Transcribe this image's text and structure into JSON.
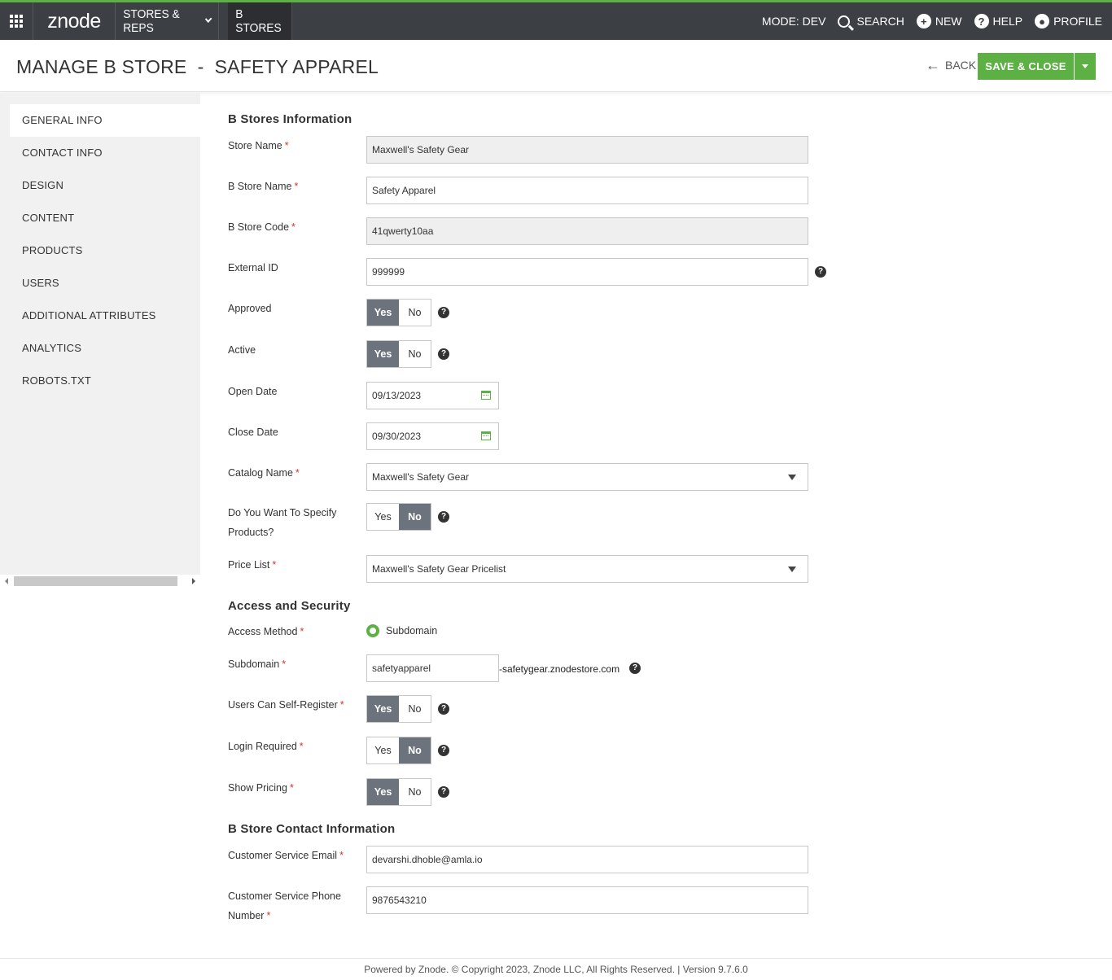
{
  "topbar": {
    "logo": "znode",
    "nav_stores": "STORES & REPS",
    "nav_bstores": "B STORES",
    "mode": "MODE: DEV",
    "search": "SEARCH",
    "new": "NEW",
    "help": "HELP",
    "profile": "PROFILE"
  },
  "header": {
    "title": "MANAGE B STORE  -  SAFETY APPAREL",
    "back": "BACK",
    "save_close": "SAVE & CLOSE"
  },
  "sidebar": {
    "items": [
      {
        "label": "GENERAL INFO",
        "active": true
      },
      {
        "label": "CONTACT INFO"
      },
      {
        "label": "DESIGN"
      },
      {
        "label": "CONTENT"
      },
      {
        "label": "PRODUCTS"
      },
      {
        "label": "USERS"
      },
      {
        "label": "ADDITIONAL ATTRIBUTES"
      },
      {
        "label": "ANALYTICS"
      },
      {
        "label": "ROBOTS.TXT"
      }
    ]
  },
  "sections": {
    "info": "B Stores Information",
    "access": "Access and Security",
    "contact": "B Store Contact Information"
  },
  "form": {
    "store_name": {
      "label": "Store Name",
      "value": "Maxwell's Safety Gear"
    },
    "bstore_name": {
      "label": "B Store Name",
      "value": "Safety Apparel"
    },
    "bstore_code": {
      "label": "B Store Code",
      "value": "41qwerty10aa"
    },
    "external_id": {
      "label": "External ID",
      "value": "999999"
    },
    "approved": {
      "label": "Approved",
      "value": "Yes"
    },
    "active": {
      "label": "Active",
      "value": "Yes"
    },
    "open_date": {
      "label": "Open Date",
      "value": "09/13/2023"
    },
    "close_date": {
      "label": "Close Date",
      "value": "09/30/2023"
    },
    "catalog_name": {
      "label": "Catalog Name",
      "value": "Maxwell's Safety Gear"
    },
    "specify_products": {
      "label": "Do You Want To Specify Products?",
      "value": "No"
    },
    "price_list": {
      "label": "Price List",
      "value": "Maxwell's Safety Gear Pricelist"
    },
    "access_method": {
      "label": "Access Method",
      "value": "Subdomain"
    },
    "subdomain": {
      "label": "Subdomain",
      "value": "safetyapparel",
      "suffix": "-safetygear.znodestore.com"
    },
    "self_register": {
      "label": "Users Can Self-Register",
      "value": "Yes"
    },
    "login_required": {
      "label": "Login Required",
      "value": "No"
    },
    "show_pricing": {
      "label": "Show Pricing",
      "value": "Yes"
    },
    "cs_email": {
      "label": "Customer Service Email",
      "value": "devarshi.dhoble@amla.io"
    },
    "cs_phone": {
      "label": "Customer Service Phone Number",
      "value": "9876543210"
    }
  },
  "toggle": {
    "yes": "Yes",
    "no": "No"
  },
  "required_mark": "*",
  "help_glyph": "?",
  "footer": "Powered by Znode. © Copyright 2023, Znode LLC, All Rights Reserved. | Version 9.7.6.0",
  "colors": {
    "brand_green": "#5db043",
    "topbar": "#3c3f44",
    "toggle_on": "#6c737d"
  }
}
